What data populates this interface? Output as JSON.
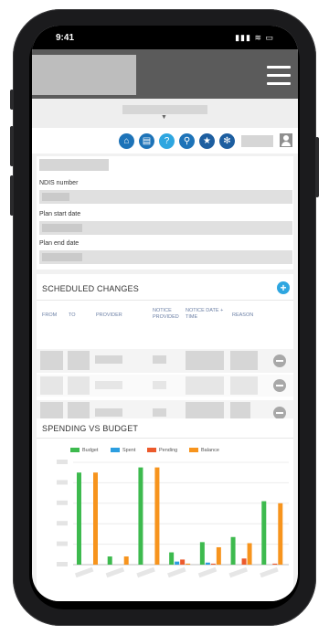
{
  "status": {
    "time": "9:41",
    "icons": "▮▮▮ ≋ ▭"
  },
  "fields": {
    "ndis_label": "NDIS number",
    "start_label": "Plan start date",
    "end_label": "Plan end date"
  },
  "scheduled": {
    "title": "SCHEDULED CHANGES",
    "add_glyph": "+",
    "columns": [
      "FROM",
      "TO",
      "PROVIDER",
      "NOTICE PROVIDED",
      "NOTICE DATE + TIME",
      "REASON"
    ]
  },
  "spending": {
    "title": "SPENDING VS BUDGET"
  },
  "chart_data": {
    "type": "bar",
    "title": "SPENDING VS BUDGET",
    "series": [
      {
        "name": "Budget",
        "color": "#3dba4e",
        "values": [
          90,
          8,
          95,
          12,
          22,
          27,
          62
        ]
      },
      {
        "name": "Spent",
        "color": "#2c9ee0",
        "values": [
          0,
          0,
          0,
          3,
          2,
          0,
          0
        ]
      },
      {
        "name": "Pending",
        "color": "#ec5a2c",
        "values": [
          0,
          0,
          0,
          5,
          1,
          6,
          1
        ]
      },
      {
        "name": "Balance",
        "color": "#f7941d",
        "values": [
          90,
          8,
          95,
          1,
          17,
          21,
          60
        ]
      }
    ],
    "categories": [
      "",
      "",
      "",
      "",
      "",
      "",
      ""
    ],
    "ylim": [
      0,
      100
    ],
    "legend": "top"
  }
}
